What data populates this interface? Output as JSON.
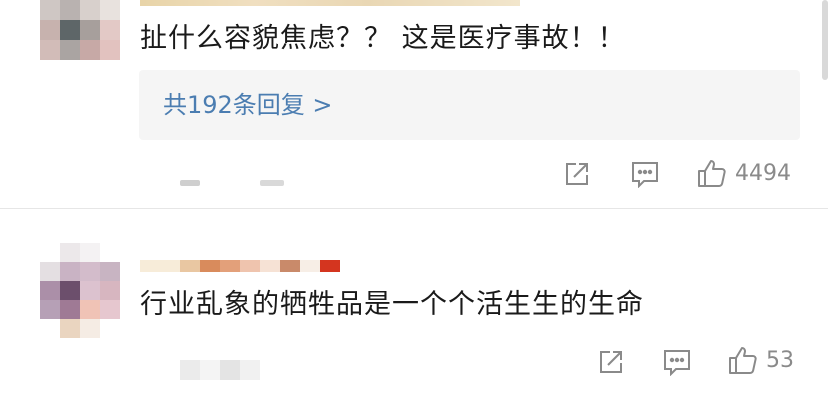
{
  "comments": [
    {
      "text": "扯什么容貌焦虑？？ 这是医疗事故！！",
      "replies_label": "共192条回复 >",
      "like_count": "4494"
    },
    {
      "text": "行业乱象的牺牲品是一个个活生生的生命",
      "like_count": "53"
    }
  ],
  "icons": {
    "share": "share-icon",
    "comment": "comment-icon",
    "like": "thumbs-up-icon"
  },
  "colors": {
    "link": "#4b7db1",
    "reply_background": "#f5f5f5",
    "icon_gray": "#8a8a8a",
    "divider": "#e6e6e6"
  }
}
